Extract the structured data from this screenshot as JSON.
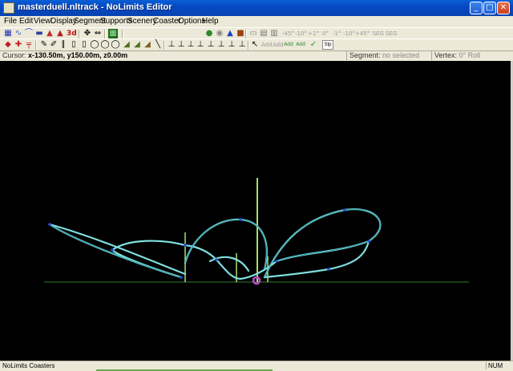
{
  "window": {
    "title": "masterduell.nltrack - NoLimits Editor",
    "controls": {
      "minimize": "_",
      "maximize": "□",
      "close": "✕"
    }
  },
  "menu": [
    "File",
    "Edit",
    "View",
    "Display",
    "Segment",
    "Supports",
    "Scenery",
    "Coaster",
    "Options",
    "Help"
  ],
  "toolbar1": {
    "left_icons": [
      "track-icon",
      "spline-icon",
      "loop-icon",
      "station-icon",
      "brake-icon"
    ],
    "label_3d": "3d",
    "dim_labels": [
      "-45°",
      "-10°",
      "+1°",
      "0°",
      "-1°",
      "-10°",
      "+45°",
      "SEG SEG SEL"
    ]
  },
  "toolbar2": {
    "add_labels": [
      "Add",
      "Add",
      "Add",
      "Add"
    ],
    "stp_label": "Stp"
  },
  "infobar": {
    "cursor_label": "Cursor:",
    "cursor_value": "x-130.50m, y150.00m, z0.00m",
    "segment_label": "Segment:",
    "segment_value": "no selected",
    "vertex_label": "Vertex:",
    "vertex_value": "0° Roll"
  },
  "statusbar": {
    "app_name": "NoLimits Coasters",
    "num_indicator": "NUM"
  },
  "colors": {
    "titlebar": "#0549c4",
    "viewport_bg": "#000000",
    "track": "#7fe0e0",
    "support": "#a6e26a",
    "ground": "#2e7d2e",
    "vertex": "#2a4fe0",
    "selection": "#c04ad0"
  }
}
